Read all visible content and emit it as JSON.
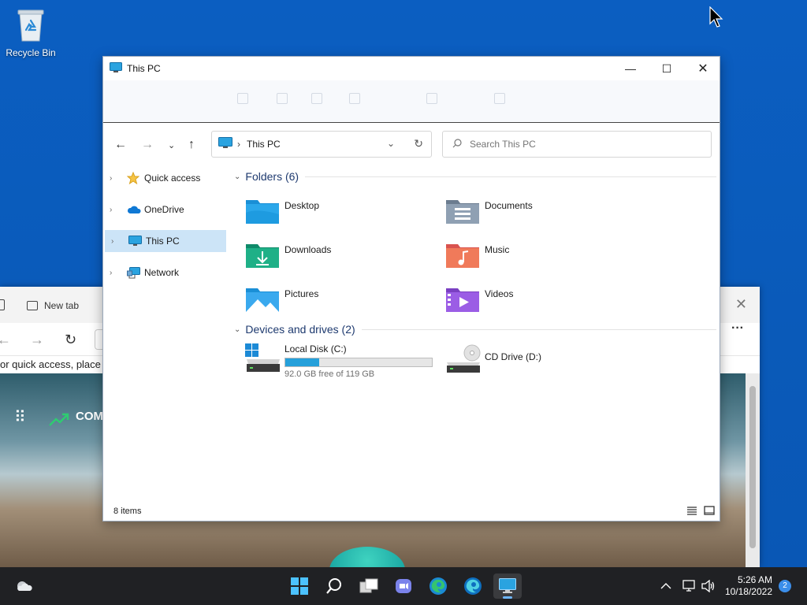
{
  "desktop": {
    "recycle_bin_label": "Recycle Bin"
  },
  "browser": {
    "tab_label": "New tab",
    "favorites_text": "or quick access, place yo",
    "widget_title": "COM"
  },
  "explorer": {
    "window_title": "This PC",
    "address": {
      "crumb": "This PC"
    },
    "search": {
      "placeholder": "Search This PC"
    },
    "nav_pane": {
      "items": [
        {
          "label": "Quick access",
          "icon": "star-icon"
        },
        {
          "label": "OneDrive",
          "icon": "cloud-icon"
        },
        {
          "label": "This PC",
          "icon": "computer-icon",
          "selected": true
        },
        {
          "label": "Network",
          "icon": "network-icon"
        }
      ]
    },
    "folders": {
      "header": "Folders (6)",
      "items": [
        {
          "label": "Desktop",
          "icon": "desktop-folder-icon"
        },
        {
          "label": "Documents",
          "icon": "documents-folder-icon"
        },
        {
          "label": "Downloads",
          "icon": "downloads-folder-icon"
        },
        {
          "label": "Music",
          "icon": "music-folder-icon"
        },
        {
          "label": "Pictures",
          "icon": "pictures-folder-icon"
        },
        {
          "label": "Videos",
          "icon": "videos-folder-icon"
        }
      ]
    },
    "drives": {
      "header": "Devices and drives (2)",
      "items": [
        {
          "label": "Local Disk (C:)",
          "free_text": "92.0 GB free of 119 GB",
          "used_fraction": 0.23
        },
        {
          "label": "CD Drive (D:)"
        }
      ]
    },
    "status": {
      "item_count": "8 items"
    }
  },
  "taskbar": {
    "time": "5:26 AM",
    "date": "10/18/2022",
    "notification_count": "2"
  },
  "colors": {
    "accent": "#0078d4",
    "selection": "#cce4f7",
    "drive_bar": "#26a0da",
    "desktop": "#0a5fc2",
    "taskbar": "#202124"
  }
}
